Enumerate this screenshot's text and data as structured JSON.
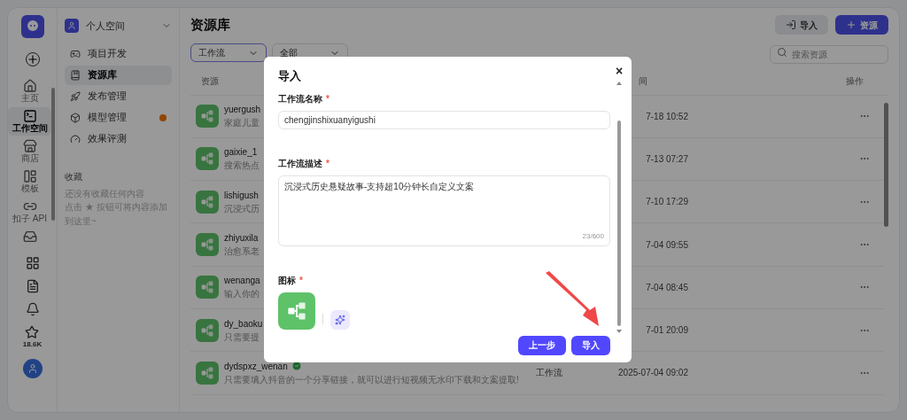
{
  "rail": {
    "items": [
      {
        "kind": "home",
        "label": "主页",
        "selected": false
      },
      {
        "kind": "workspace",
        "label": "工作空间",
        "selected": true
      },
      {
        "kind": "store",
        "label": "商店",
        "selected": false
      },
      {
        "kind": "template",
        "label": "模板",
        "selected": false
      },
      {
        "kind": "api",
        "label": "扣子 API",
        "selected": false
      },
      {
        "kind": "inbox",
        "selected": false
      }
    ],
    "bottom": [
      {
        "kind": "apps"
      },
      {
        "kind": "doc"
      },
      {
        "kind": "bell"
      },
      {
        "kind": "star",
        "label": "18.6K"
      },
      {
        "kind": "avatar"
      }
    ]
  },
  "sidebar": {
    "space": "个人空间",
    "items": [
      {
        "kind": "project",
        "label": "项目开发",
        "selected": false,
        "badge": false
      },
      {
        "kind": "library",
        "label": "资源库",
        "selected": true,
        "badge": false
      },
      {
        "kind": "publish",
        "label": "发布管理",
        "selected": false,
        "badge": false
      },
      {
        "kind": "model",
        "label": "模型管理",
        "selected": false,
        "badge": true
      },
      {
        "kind": "eval",
        "label": "效果评测",
        "selected": false,
        "badge": false
      }
    ],
    "favorites_title": "收藏",
    "favorites_empty": "还没有收藏任何内容",
    "favorites_hint": "点击 ★ 按钮可将内容添加到这里~"
  },
  "main": {
    "title": "资源库",
    "import_button": "导入",
    "add_button": "资源",
    "filters": [
      {
        "value": "工作流",
        "focused": true
      },
      {
        "value": "全部",
        "focused": false
      }
    ],
    "search": {
      "placeholder": "搜索资源"
    },
    "table": {
      "columns": [
        "资源",
        "间",
        "操作"
      ],
      "rows": [
        {
          "name": "yuergush",
          "desc": "家庭儿童",
          "time": "7-18 10:52"
        },
        {
          "name": "gaixie_1",
          "desc": "搜索热点",
          "time": "7-13 07:27"
        },
        {
          "name": "lishigush",
          "desc": "沉浸式历",
          "time": "7-10 17:29"
        },
        {
          "name": "zhiyuxila",
          "desc": "治愈系老",
          "time": "7-04 09:55"
        },
        {
          "name": "wenanga",
          "desc": "输入你的",
          "time": "7-04 08:45"
        },
        {
          "name": "dy_baoku",
          "desc": "只需要提",
          "time": "7-01 20:09"
        },
        {
          "name": "dydspxz_wenan",
          "desc": "只需要填入抖音的一个分享链接，就可以进行短视频无水印下载和文案提取!",
          "type": "工作流",
          "time": "2025-07-04 09:02",
          "verified": true
        }
      ]
    }
  },
  "dialog": {
    "title": "导入",
    "close": "×",
    "name_label": "工作流名称",
    "name_mark": "*",
    "name_value": "chengjinshixuanyigushi",
    "desc_label": "工作流描述",
    "desc_mark": "*",
    "desc_value": "沉浸式历史悬疑故事-支持超10分钟长自定义文案",
    "desc_count": "23/600",
    "icon_label": "图标",
    "icon_mark": "*",
    "back_button": "上一步",
    "import_button": "导入"
  }
}
